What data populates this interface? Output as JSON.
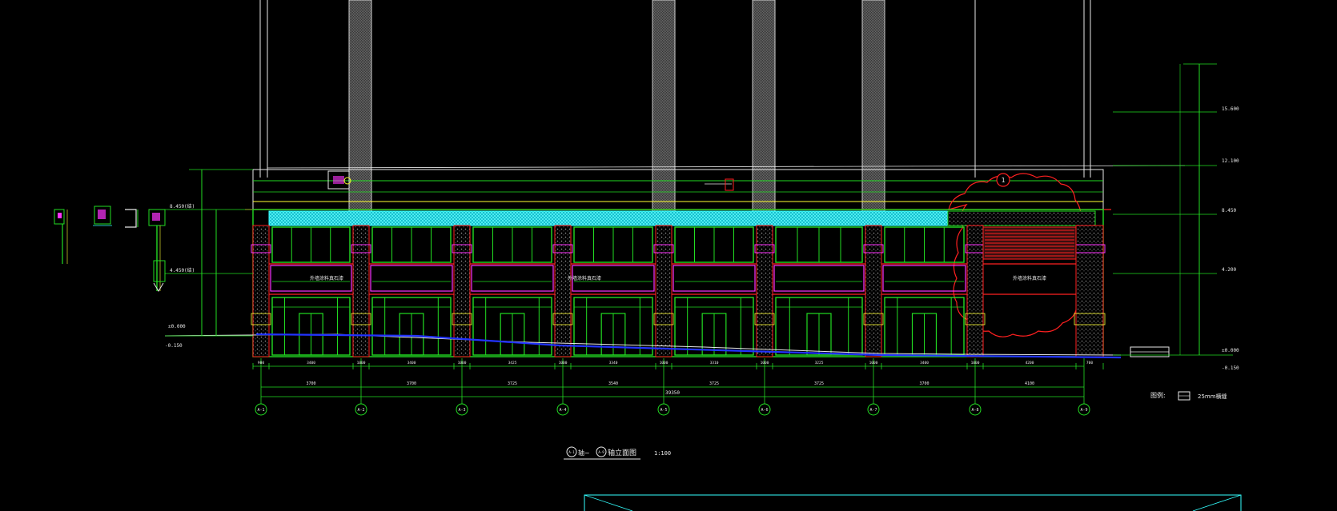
{
  "drawing": {
    "title": "轴立面图",
    "title_prefix_from": "A-1",
    "title_prefix_axis": "轴~",
    "title_prefix_to": "A-9",
    "scale": "1:100",
    "legend_label": "图例:",
    "legend_text": "25mm横缝",
    "total_dim": "39350"
  },
  "axes": [
    "A-1",
    "A-2",
    "A-3",
    "A-4",
    "A-5",
    "A-6",
    "A-7",
    "A-8",
    "A-9"
  ],
  "bay_dims": [
    "3700",
    "3700",
    "3725",
    "3540",
    "3725",
    "3725",
    "3700",
    "4100"
  ],
  "sub_dims": [
    "900",
    "3400",
    "1000",
    "3400",
    "1000",
    "3425",
    "1000",
    "3340",
    "1000",
    "3310",
    "1000",
    "3225",
    "1000",
    "3400",
    "1000",
    "4200",
    "700"
  ],
  "elev_left": [
    "8.450(结)",
    "4.450(结)",
    "±0.000",
    "-0.150"
  ],
  "elev_right": [
    "15.600",
    "12.100",
    "8.450",
    "4.200",
    "±0.000",
    "-0.150"
  ],
  "facade_labels": [
    "外墙涂料真石漆",
    "外墙涂料真石漆",
    "外墙涂料真石漆"
  ],
  "revision_mark": "1",
  "colors": {
    "background": "#000000",
    "green": "#22dd22",
    "red": "#ff2020",
    "magenta": "#ff33ff",
    "cyan": "#33ffff",
    "yellow": "#ffff33",
    "white": "#e8e8e8",
    "blue": "#2233ff"
  }
}
